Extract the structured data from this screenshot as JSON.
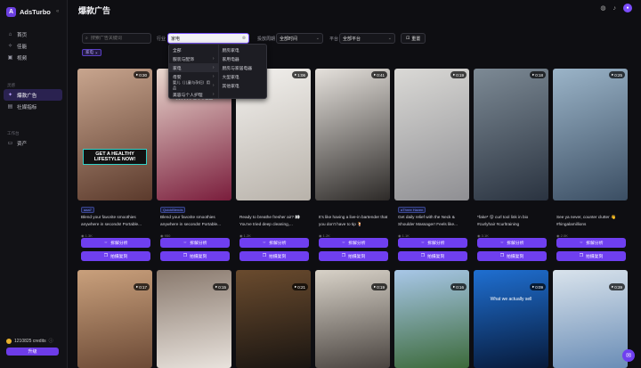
{
  "brand": {
    "name": "AdsTurbo",
    "logo_letter": "A"
  },
  "sidebar": {
    "top_items": [
      {
        "label": "首页",
        "icon": "home-icon"
      },
      {
        "label": "佳能",
        "icon": "star-icon"
      },
      {
        "label": "视频",
        "icon": "video-icon"
      }
    ],
    "group1_label": "灵感",
    "group1_items": [
      {
        "label": "爆款广告",
        "icon": "fire-icon",
        "active": true
      },
      {
        "label": "社媒指标",
        "icon": "chart-icon"
      }
    ],
    "group2_label": "工作台",
    "group2_items": [
      {
        "label": "资产",
        "icon": "folder-icon"
      }
    ],
    "credits": "1210825 credits",
    "upgrade": "升级"
  },
  "header": {
    "title": "爆款广告"
  },
  "filters": {
    "search_placeholder": "搜索广告关键词",
    "industry_label": "行业",
    "industry_value": "家电",
    "time_label": "投放周期",
    "time_value": "全部时间",
    "platform_label": "平台",
    "platform_value": "全部平台",
    "reset": "重置",
    "chip": "家电"
  },
  "dropdown": {
    "left": [
      {
        "label": "全部",
        "has_sub": false
      },
      {
        "label": "服装与配饰",
        "has_sub": true
      },
      {
        "label": "家电",
        "has_sub": true,
        "selected": true
      },
      {
        "label": "母婴",
        "has_sub": true
      },
      {
        "label": "婴儿（儿童与孕妇）用品",
        "has_sub": true
      },
      {
        "label": "美容与个人护理",
        "has_sub": true
      }
    ],
    "right": [
      {
        "label": "厨房家电"
      },
      {
        "label": "家用电器"
      },
      {
        "label": "厨房与家居电器"
      },
      {
        "label": "大型家电"
      },
      {
        "label": "其他家电"
      }
    ]
  },
  "cards": [
    {
      "duration": "0:30",
      "tag": "aaa7",
      "desc": "Blend your favorite smoothies anywhere in seconds! Portable...",
      "meta": "1.3K",
      "overlay": "GET A HEALTHY LIFESTYLE NOW!",
      "c1": "#5b3a2c",
      "c2": "#c8a58e"
    },
    {
      "duration": "0:33",
      "tag": "QuickBlends",
      "desc": "Blend your favorite smoothies anywhere in seconds! Portable...",
      "meta": "950",
      "overlay": "WITH STYLE",
      "c1": "#7a1d3c",
      "c2": "#e9d8ce"
    },
    {
      "duration": "1:06",
      "tag": "",
      "desc": "Ready to breathe fresher air? 👀 You've tried deep cleaning,...",
      "meta": "1.2K",
      "overlay": "",
      "c1": "#b8b2aa",
      "c2": "#f3f1ee"
    },
    {
      "duration": "0:41",
      "tag": "",
      "desc": "It's like having a live-in bartender that you don't have to tip 🍹",
      "meta": "1.2K",
      "overlay": "",
      "c1": "#2d2a28",
      "c2": "#e5e1dc"
    },
    {
      "duration": "0:19",
      "tag": "aThree Haven",
      "desc": "Get daily relief with the Neck & Shoulder Massager! Feels like...",
      "meta": "1.1K",
      "overlay": "",
      "c1": "#8f8f93",
      "c2": "#dad9d6"
    },
    {
      "duration": "0:18",
      "tag": "",
      "desc": "*fake* 😮 curl tool link in bio #curlyhair #curltraining",
      "meta": "3.1K",
      "overlay": "",
      "c1": "#2a3340",
      "c2": "#7d8a95"
    },
    {
      "duration": "0:25",
      "tag": "",
      "desc": "See ya never, counter clutter 👋 #hingalamillions",
      "meta": "2.0K",
      "overlay": "",
      "c1": "#3b4e63",
      "c2": "#9bb4c8"
    }
  ],
  "row2": [
    {
      "duration": "0:17",
      "c1": "#6c4a36",
      "c2": "#c9a07c"
    },
    {
      "duration": "0:15",
      "c1": "#e8e2dc",
      "c2": "#8a7a6e"
    },
    {
      "duration": "0:21",
      "c1": "#1a1511",
      "c2": "#6a4b2e"
    },
    {
      "duration": "0:19",
      "c1": "#4a4440",
      "c2": "#d8d2c8"
    },
    {
      "duration": "0:16",
      "c1": "#3c6a3a",
      "c2": "#a8c7e8"
    },
    {
      "duration": "0:09",
      "c1": "#071a3a",
      "c2": "#1f6fd1",
      "overlay": "What we actually sell"
    },
    {
      "duration": "0:39",
      "c1": "#6a8db6",
      "c2": "#d9e3ec"
    }
  ],
  "buttons": {
    "analyze": "拆解分析",
    "copy": "拍摄复刻"
  },
  "colors": {
    "accent": "#6f3ff0",
    "sidebar_active": "#2a2250"
  }
}
